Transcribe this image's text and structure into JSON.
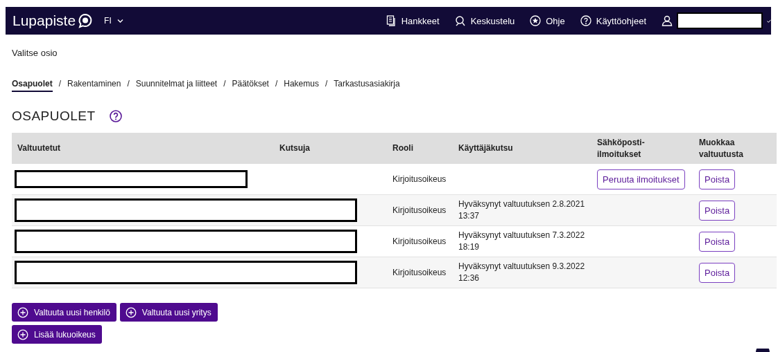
{
  "header": {
    "logo": "Lupapiste",
    "language": "FI",
    "nav": [
      {
        "kind": "documents",
        "label": "Hankkeet"
      },
      {
        "kind": "chat",
        "label": "Keskustelu"
      },
      {
        "kind": "star",
        "label": "Ohje"
      },
      {
        "kind": "help",
        "label": "Käyttöohjeet"
      }
    ]
  },
  "section_prompt": "Valitse osio",
  "tabs": [
    {
      "label": "Osapuolet",
      "selected": true
    },
    {
      "label": "Rakentaminen",
      "selected": false
    },
    {
      "label": "Suunnitelmat ja liitteet",
      "selected": false
    },
    {
      "label": "Päätökset",
      "selected": false
    },
    {
      "label": "Hakemus",
      "selected": false
    },
    {
      "label": "Tarkastusasiakirja",
      "selected": false
    }
  ],
  "tab_separator": "/",
  "section_title": "OSAPUOLET",
  "table": {
    "columns": [
      "Valtuutetut",
      "Kutsuja",
      "Rooli",
      "Käyttäjäkutsu",
      "Sähköposti-ilmoitukset",
      "Muokkaa valtuutusta"
    ],
    "rows": [
      {
        "kind": "short",
        "role": "Kirjoitusoikeus",
        "email_action": "Peruuta ilmoitukset",
        "edit_action": "Poista"
      },
      {
        "kind": "long",
        "role": "Kirjoitusoikeus",
        "invitation": "Hyväksynyt valtuutuksen 2.8.2021 13:37",
        "edit_action": "Poista"
      },
      {
        "kind": "long",
        "role": "Kirjoitusoikeus",
        "invitation": "Hyväksynyt valtuutuksen 7.3.2022 18:19",
        "edit_action": "Poista"
      },
      {
        "kind": "long",
        "role": "Kirjoitusoikeus",
        "invitation": "Hyväksynyt valtuutuksen 9.3.2022 12:36",
        "edit_action": "Poista"
      }
    ]
  },
  "actions": [
    "Valtuuta uusi henkilö",
    "Valtuuta uusi yritys",
    "Lisää lukuoikeus"
  ]
}
